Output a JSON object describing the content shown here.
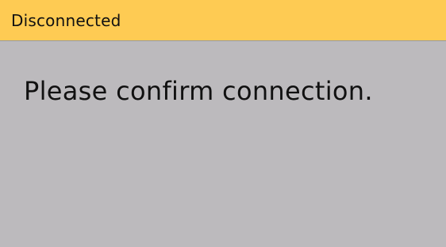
{
  "title_bar": {
    "text": "Disconnected",
    "background_color": "#fecb53"
  },
  "body": {
    "message": "Please confirm connection.",
    "background_color": "#bcbabd"
  }
}
